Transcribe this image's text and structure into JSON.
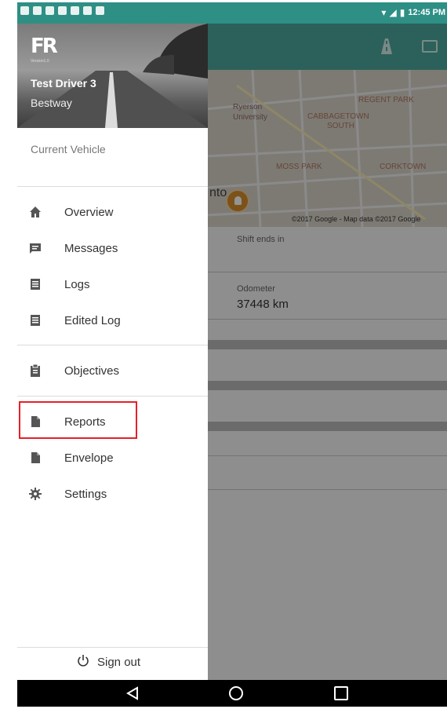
{
  "status_bar": {
    "time": "12:45 PM"
  },
  "map": {
    "labels": [
      "Ryerson",
      "University",
      "REGENT PARK",
      "CABBAGETOWN",
      "SOUTH",
      "MOSS PARK",
      "CORKTOWN"
    ],
    "city": "nto",
    "attribution": "©2017 Google - Map data ©2017 Google"
  },
  "dashboard": {
    "shift_label": "Shift ends in",
    "odometer_label": "Odometer",
    "odometer_value": "37448  km"
  },
  "drawer": {
    "logo": "FR",
    "logo_version": "Version1.0",
    "driver_name": "Test Driver 3",
    "company": "Bestway",
    "current_vehicle": "Current Vehicle",
    "menu": [
      {
        "label": "Overview",
        "icon": "home-icon"
      },
      {
        "label": "Messages",
        "icon": "message-icon"
      },
      {
        "label": "Logs",
        "icon": "logs-icon"
      },
      {
        "label": "Edited Log",
        "icon": "edited-log-icon"
      },
      {
        "label": "Objectives",
        "icon": "clipboard-icon"
      },
      {
        "label": "Reports",
        "icon": "document-icon"
      },
      {
        "label": "Envelope",
        "icon": "document-icon"
      },
      {
        "label": "Settings",
        "icon": "gear-icon"
      }
    ],
    "sign_out": "Sign out"
  },
  "colors": {
    "status_bar": "#2e8f85",
    "app_bar": "#4aa89b",
    "highlight": "#e5202a"
  }
}
